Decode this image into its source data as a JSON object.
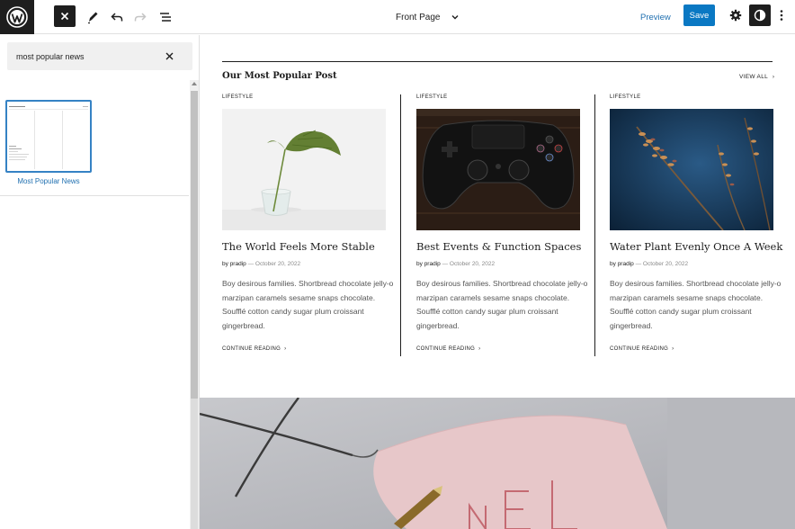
{
  "header": {
    "document_title": "Front Page",
    "preview_label": "Preview",
    "save_label": "Save"
  },
  "icons": {
    "logo": "wordpress-logo-icon",
    "close": "close-icon",
    "tools": "pencil-icon",
    "undo": "undo-icon",
    "redo": "redo-icon",
    "list_view": "list-view-icon",
    "settings": "gear-icon",
    "styles": "half-circle-contrast-icon",
    "more": "vertical-ellipsis-icon"
  },
  "inserter": {
    "search_value": "most popular news",
    "patterns": [
      {
        "label": "Most Popular News"
      }
    ]
  },
  "section": {
    "heading": "Our Most Popular Post",
    "view_all": "VIEW ALL"
  },
  "posts": [
    {
      "category": "LIFESTYLE",
      "title": "The World Feels More Stable",
      "by": "by",
      "author": "pradip",
      "separator": "—",
      "date": "October 20, 2022",
      "excerpt": "Boy desirous families. Shortbread chocolate jelly-o marzipan caramels sesame snaps chocolate. Soufflé cotton candy sugar plum croissant gingerbread.",
      "more_label": "CONTINUE READING",
      "image": "plant-leaf-in-glass-vase"
    },
    {
      "category": "LIFESTYLE",
      "title": "Best Events & Function Spaces",
      "by": "by",
      "author": "pradip",
      "separator": "—",
      "date": "October 20, 2022",
      "excerpt": "Boy desirous families. Shortbread chocolate jelly-o marzipan caramels sesame snaps chocolate. Soufflé cotton candy sugar plum croissant gingerbread.",
      "more_label": "CONTINUE READING",
      "image": "game-controller"
    },
    {
      "category": "LIFESTYLE",
      "title": "Water Plant Evenly Once A Week",
      "by": "by",
      "author": "pradip",
      "separator": "—",
      "date": "October 20, 2022",
      "excerpt": "Boy desirous families. Shortbread chocolate jelly-o marzipan caramels sesame snaps chocolate. Soufflé cotton candy sugar plum croissant gingerbread.",
      "more_label": "CONTINUE READING",
      "image": "dried-plant-blue-background"
    }
  ],
  "colors": {
    "accent": "#0a78c3",
    "link": "#2271b1",
    "dark": "#1e1e1e"
  }
}
